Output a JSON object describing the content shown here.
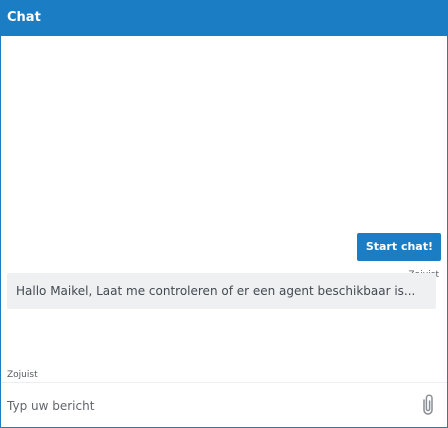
{
  "header": {
    "title": "Chat"
  },
  "messages": [
    {
      "direction": "outgoing",
      "text": "Start chat!",
      "time": "Zojuist"
    },
    {
      "direction": "incoming",
      "text": "Hallo Maikel, Laat me controleren of er een agent beschikbaar is...",
      "time": "Zojuist"
    }
  ],
  "composer": {
    "placeholder": "Typ uw bericht",
    "value": "",
    "attach_icon": "paperclip-icon"
  },
  "colors": {
    "brand": "#1b7ec4",
    "incoming_bubble": "#eef0f2",
    "text": "#444a50",
    "muted_text": "#555a60"
  }
}
